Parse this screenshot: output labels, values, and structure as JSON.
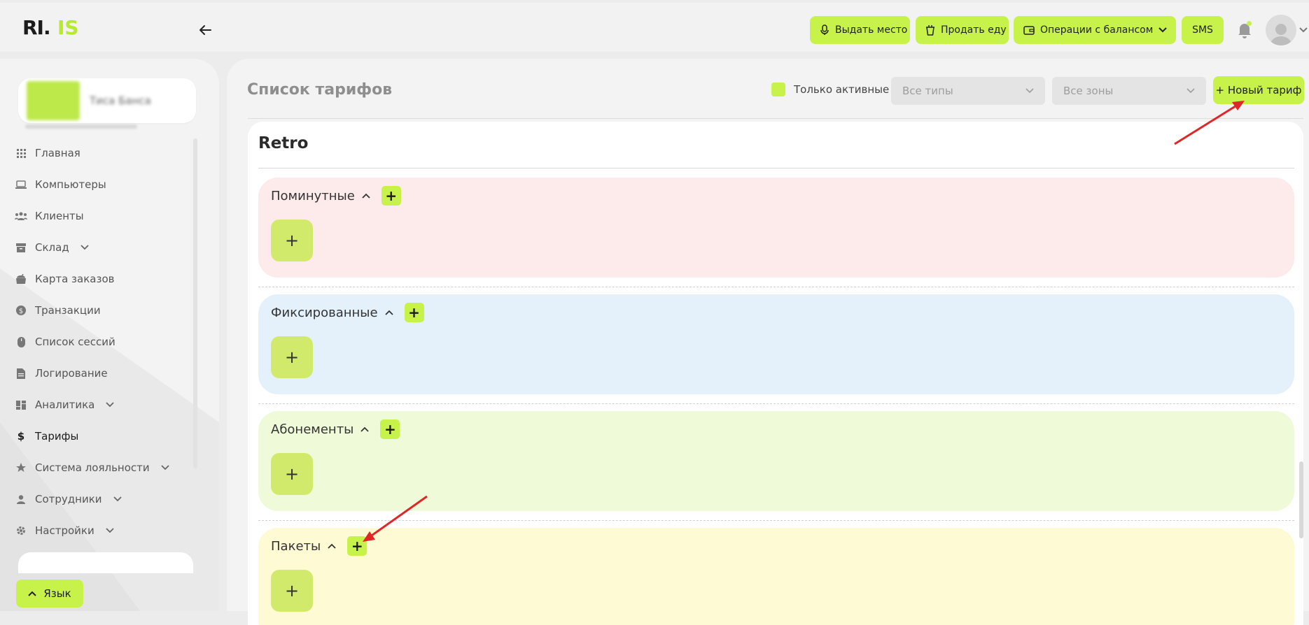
{
  "brand": {
    "logo_text": "RI.IS",
    "accent": "#c6f24a"
  },
  "topbar": {
    "buttons": [
      {
        "label": "Выдать место",
        "icon": "microphone-icon"
      },
      {
        "label": "Продать еду",
        "icon": "cup-icon"
      },
      {
        "label": "Операции с балансом",
        "icon": "wallet-icon"
      },
      {
        "label": "SMS"
      }
    ]
  },
  "sidebar": {
    "club": {
      "name": "Тиса Банса"
    },
    "items": [
      {
        "label": "Главная",
        "icon": "grid-icon"
      },
      {
        "label": "Компьютеры",
        "icon": "laptop-icon"
      },
      {
        "label": "Клиенты",
        "icon": "users-icon"
      },
      {
        "label": "Склад",
        "icon": "archive-icon"
      },
      {
        "label": "Карта заказов",
        "icon": "food-icon"
      },
      {
        "label": "Транзакции",
        "icon": "coin-icon"
      },
      {
        "label": "Список сессий",
        "icon": "mouse-icon"
      },
      {
        "label": "Логирование",
        "icon": "file-icon"
      },
      {
        "label": "Аналитика",
        "icon": "dashboard-icon"
      },
      {
        "label": "Тарифы",
        "icon": "dollar-icon",
        "active": true
      },
      {
        "label": "Система лояльности",
        "icon": "star-icon"
      },
      {
        "label": "Сотрудники",
        "icon": "user-icon"
      },
      {
        "label": "Настройки",
        "icon": "gear-icon"
      }
    ],
    "language_label": "Язык"
  },
  "main": {
    "title": "Список тарифов",
    "only_active_label": "Только активные",
    "type_select": "Все типы",
    "zone_select": "Все зоны",
    "new_tariff_label": "+ Новый тариф",
    "zone": {
      "name": "Retro",
      "groups": [
        {
          "name": "Поминутные",
          "color": "#fdeaea"
        },
        {
          "name": "Фиксированные",
          "color": "#e4f1fb"
        },
        {
          "name": "Абонементы",
          "color": "#effbd8"
        },
        {
          "name": "Пакеты",
          "color": "#fefad4"
        }
      ]
    }
  }
}
